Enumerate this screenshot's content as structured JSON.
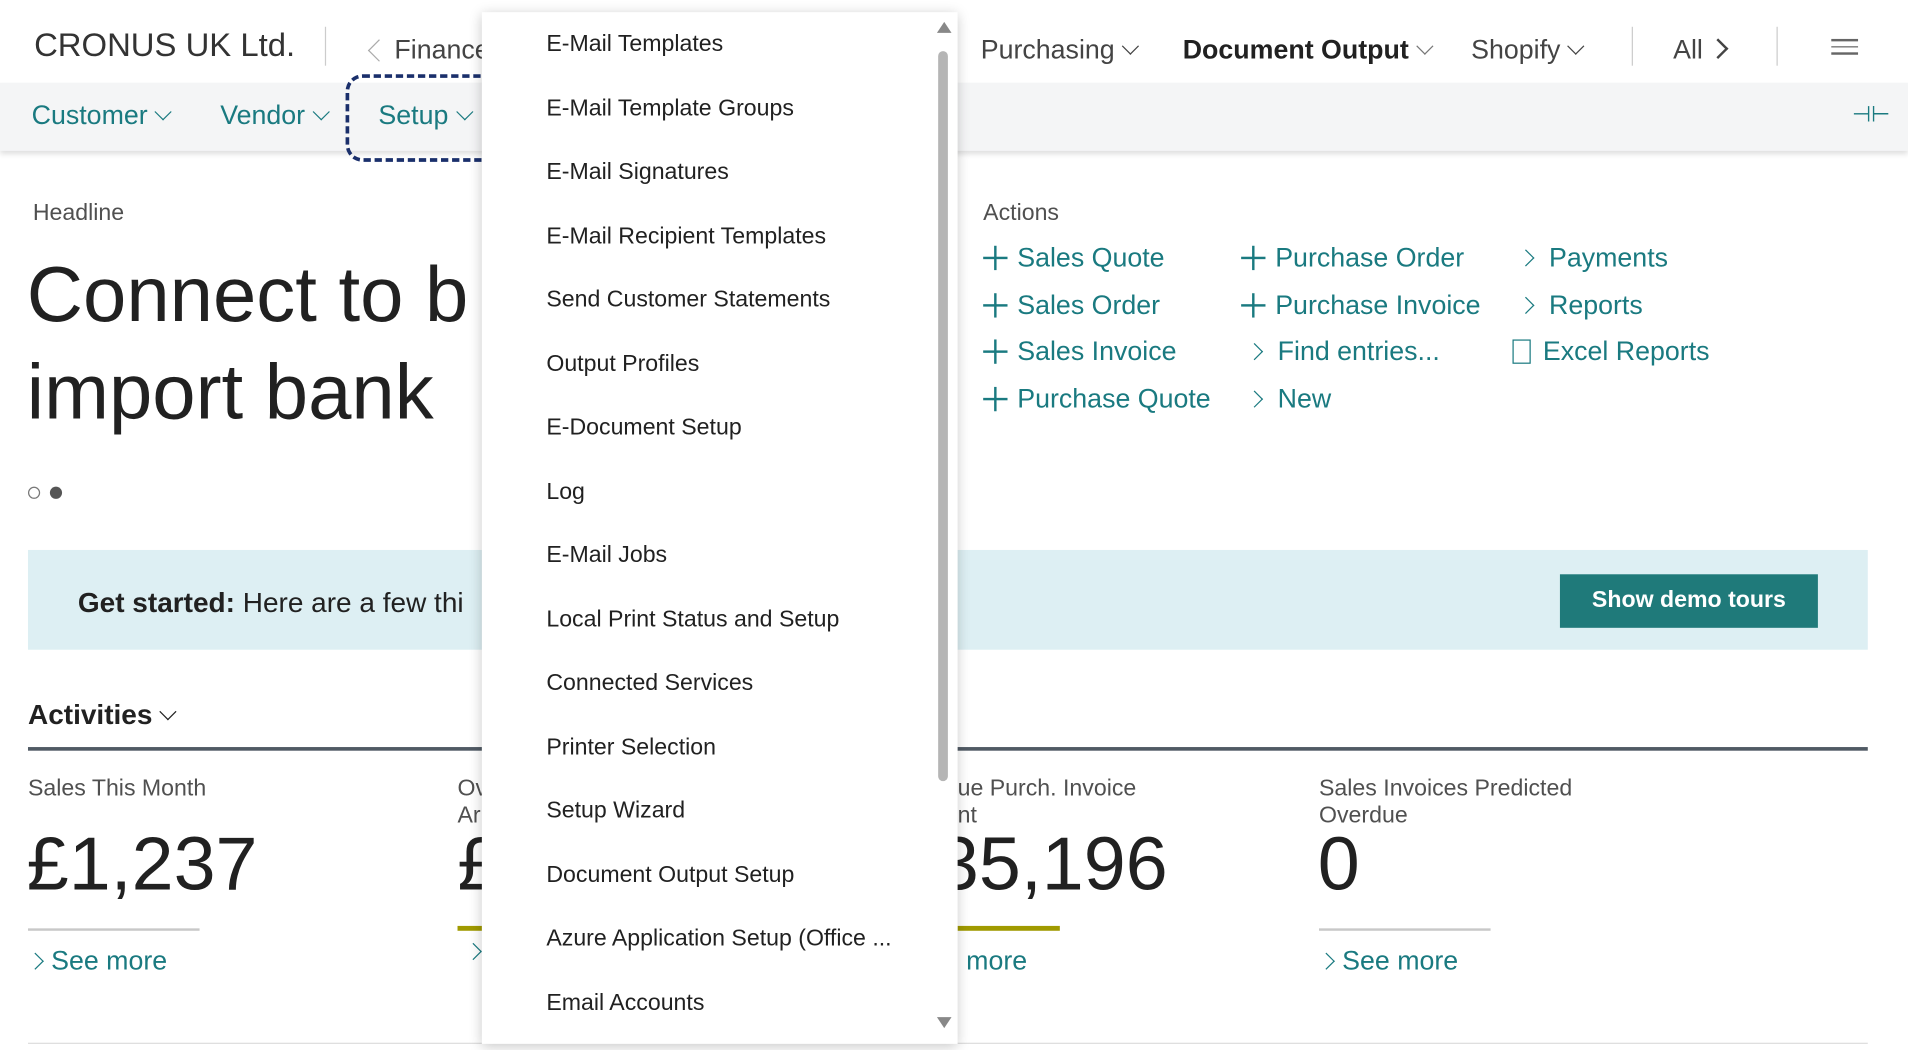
{
  "header": {
    "company": "CRONUS UK Ltd.",
    "nav": [
      {
        "label": "Finance"
      },
      {
        "label": "Purchasing"
      },
      {
        "label": "Document Output"
      },
      {
        "label": "Shopify"
      },
      {
        "label": "All"
      }
    ]
  },
  "subnav": [
    {
      "label": "Customer"
    },
    {
      "label": "Vendor"
    },
    {
      "label": "Setup"
    }
  ],
  "headline": {
    "label": "Headline",
    "line1": "Connect to b",
    "line2": "import bank"
  },
  "banner": {
    "bold": "Get started:",
    "text": "Here are a few thi",
    "button": "Show demo tours"
  },
  "actions": {
    "label": "Actions",
    "items": [
      {
        "label": "Sales Quote",
        "icon": "plus-icon"
      },
      {
        "label": "Sales Order",
        "icon": "plus-icon"
      },
      {
        "label": "Sales Invoice",
        "icon": "plus-icon"
      },
      {
        "label": "Purchase Quote",
        "icon": "plus-icon"
      },
      {
        "label": "Purchase Order",
        "icon": "plus-icon"
      },
      {
        "label": "Purchase Invoice",
        "icon": "plus-icon"
      },
      {
        "label": "Find entries...",
        "icon": "chevron-right-icon"
      },
      {
        "label": "New",
        "icon": "chevron-right-icon"
      },
      {
        "label": "Payments",
        "icon": "chevron-right-icon"
      },
      {
        "label": "Reports",
        "icon": "chevron-right-icon"
      },
      {
        "label": "Excel Reports",
        "icon": "document-icon"
      }
    ]
  },
  "activities": {
    "title": "Activities",
    "tiles": [
      {
        "title": "Sales This Month",
        "value": "£1,237",
        "link": "See more"
      },
      {
        "title": "Ov",
        "title2": "Ar",
        "value": "£",
        "link": ""
      },
      {
        "title": "ue Purch. Invoice",
        "title2": "nt",
        "value": "35,196",
        "link": "more"
      },
      {
        "title": "Sales Invoices Predicted",
        "title2": "Overdue",
        "value": "0",
        "link": "See more"
      }
    ]
  },
  "menu": {
    "items": [
      "E-Mail Templates",
      "E-Mail Template Groups",
      "E-Mail Signatures",
      "E-Mail Recipient Templates",
      "Send Customer Statements",
      "Output Profiles",
      "E-Document Setup",
      "Log",
      "E-Mail Jobs",
      "Local Print Status and Setup",
      "Connected Services",
      "Printer Selection",
      "Setup Wizard",
      "Document Output Setup",
      "Azure Application Setup (Office ...",
      "Email Accounts"
    ]
  },
  "colors": {
    "accent": "#1a7a80",
    "button": "#1f7a7a",
    "banner": "#ddeff3",
    "focus": "#1a2f6b",
    "tile_bar": "#a09a00"
  }
}
